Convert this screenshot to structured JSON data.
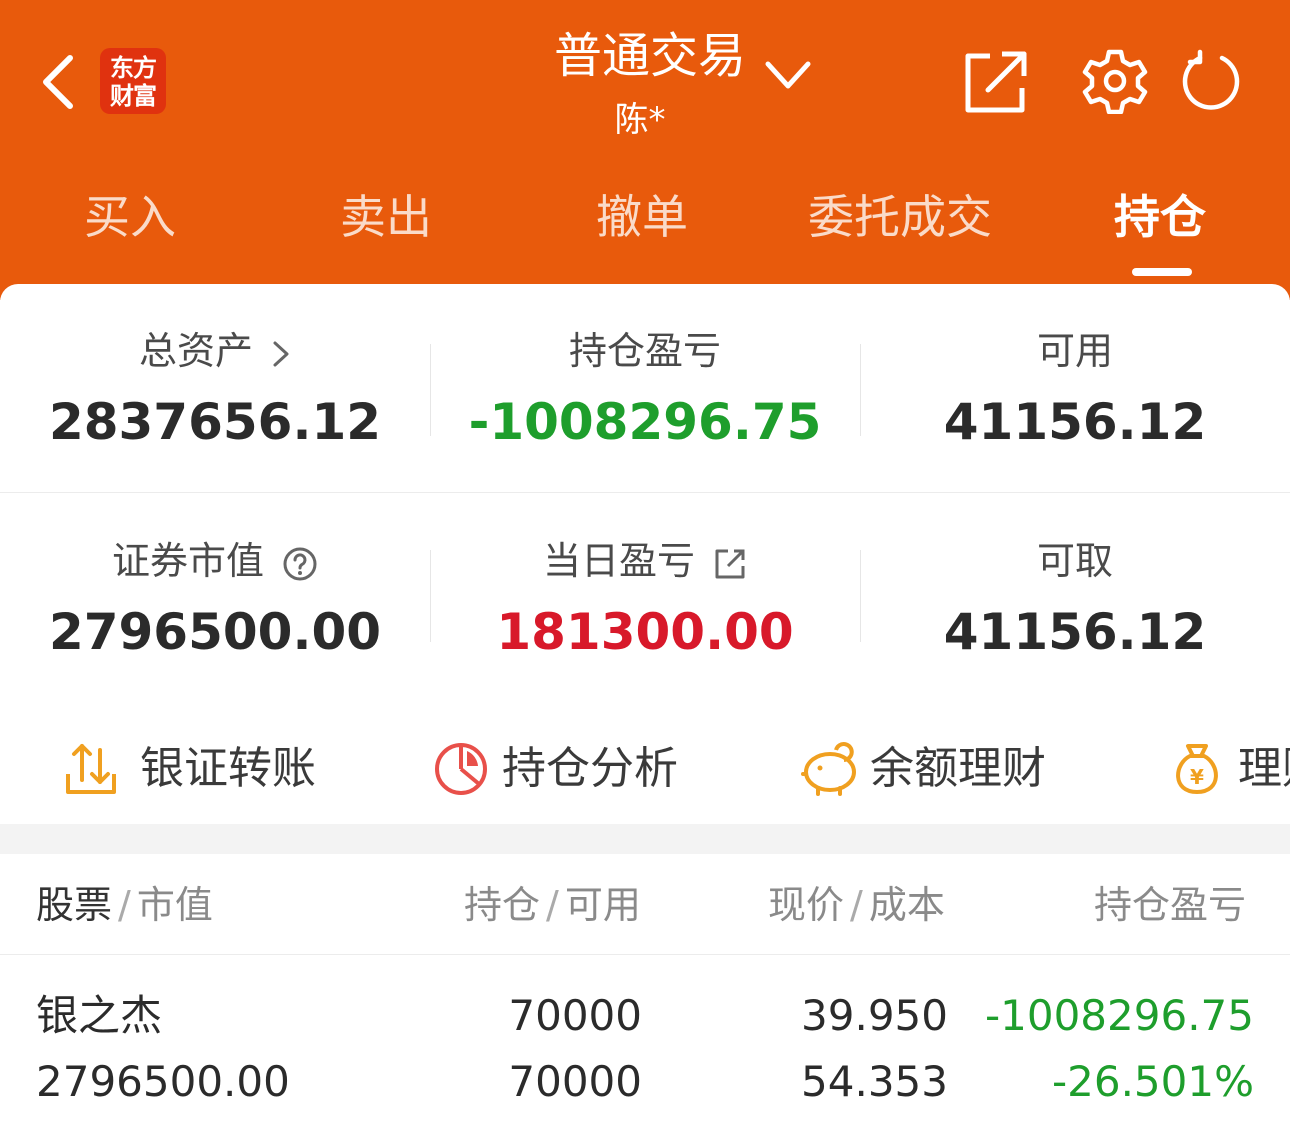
{
  "header": {
    "logo_line1": "东方",
    "logo_line2": "财富",
    "title": "普通交易",
    "subtitle": "陈*",
    "icons": [
      "back-icon",
      "chevron-down-icon",
      "share-icon",
      "gear-icon",
      "refresh-icon"
    ]
  },
  "tabs": [
    {
      "label": "买入"
    },
    {
      "label": "卖出"
    },
    {
      "label": "撤单"
    },
    {
      "label": "委托成交"
    },
    {
      "label": "持仓",
      "active": true
    }
  ],
  "summary": {
    "total_assets_label": "总资产",
    "total_assets": "2837656.12",
    "position_pl_label": "持仓盈亏",
    "position_pl": "-1008296.75",
    "available_label": "可用",
    "available": "41156.12",
    "market_value_label": "证券市值",
    "market_value": "2796500.00",
    "daily_pl_label": "当日盈亏",
    "daily_pl": "181300.00",
    "withdrawable_label": "可取",
    "withdrawable": "41156.12"
  },
  "shortcuts": [
    {
      "label": "银证转账",
      "icon": "transfer-icon"
    },
    {
      "label": "持仓分析",
      "icon": "pie-chart-icon"
    },
    {
      "label": "余额理财",
      "icon": "piggy-bank-icon"
    },
    {
      "label": "理财",
      "icon": "money-bag-icon"
    }
  ],
  "table": {
    "col1_a": "股票",
    "col1_b": "市值",
    "col2_a": "持仓",
    "col2_b": "可用",
    "col3_a": "现价",
    "col3_b": "成本",
    "col4": "持仓盈亏",
    "rows": [
      {
        "name": "银之杰",
        "market_value": "2796500.00",
        "position": "70000",
        "available": "70000",
        "price": "39.950",
        "cost": "54.353",
        "pl": "-1008296.75",
        "pl_pct": "-26.501%"
      }
    ]
  },
  "colors": {
    "brand": "#e85a0c",
    "gain": "#d8192a",
    "loss": "#1e9e2c",
    "icon_orange": "#f0a020",
    "icon_red": "#e8504a"
  }
}
